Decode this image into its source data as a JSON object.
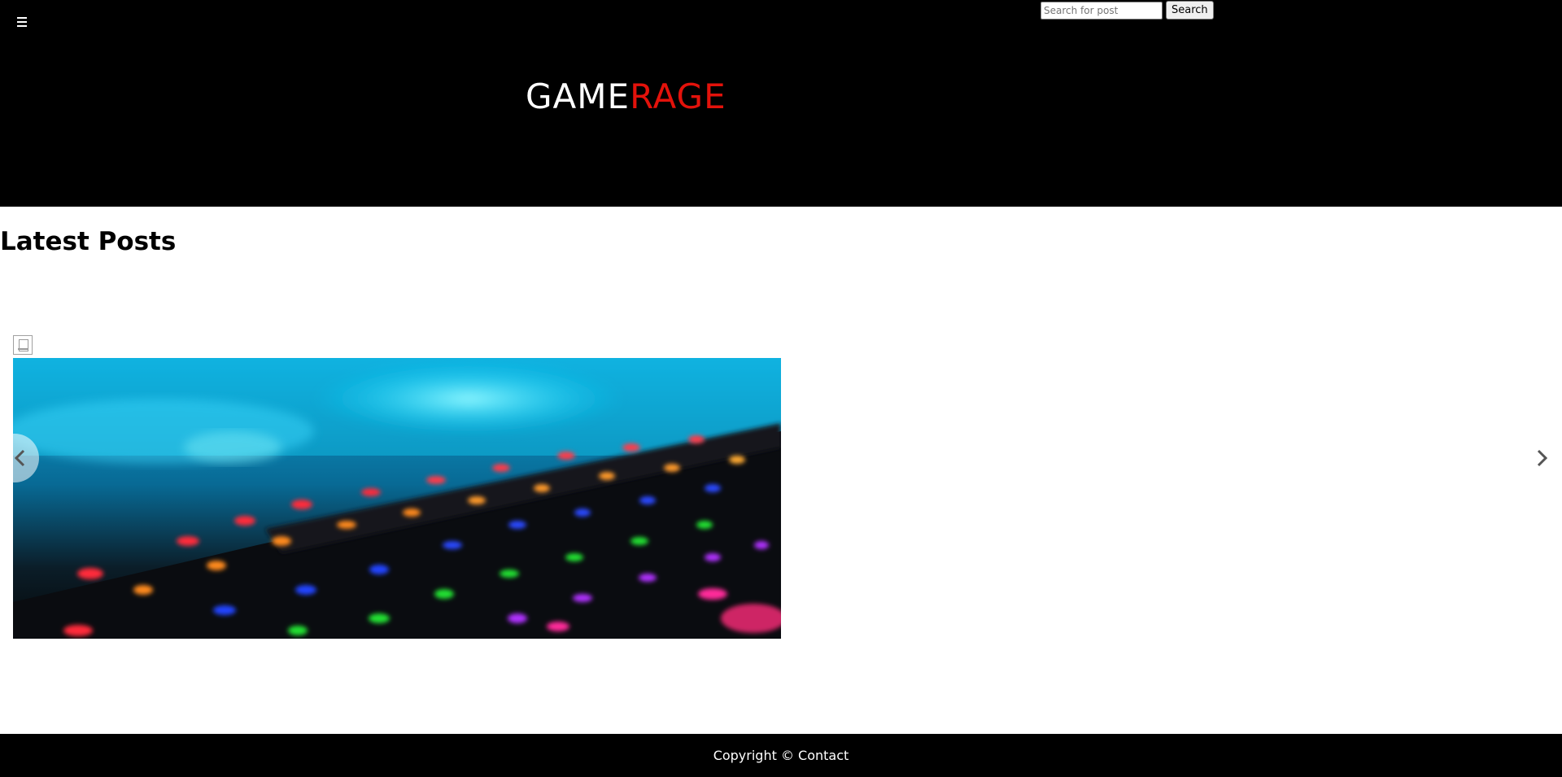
{
  "header": {
    "menu_icon": "hamburger-menu-icon",
    "logo_part1": "GAME",
    "logo_part2": "RAGE",
    "logo_colors": {
      "primary": "#ffffff",
      "accent": "#e3120b"
    },
    "search": {
      "placeholder": "Search for post",
      "value": "",
      "button_label": "Search"
    }
  },
  "main": {
    "section_title": "Latest Posts",
    "carousel": {
      "broken_image_icon": "broken-image-icon",
      "prev_icon": "chevron-left-icon",
      "next_icon": "chevron-right-icon"
    }
  },
  "footer": {
    "text": "Copyright © Contact"
  }
}
